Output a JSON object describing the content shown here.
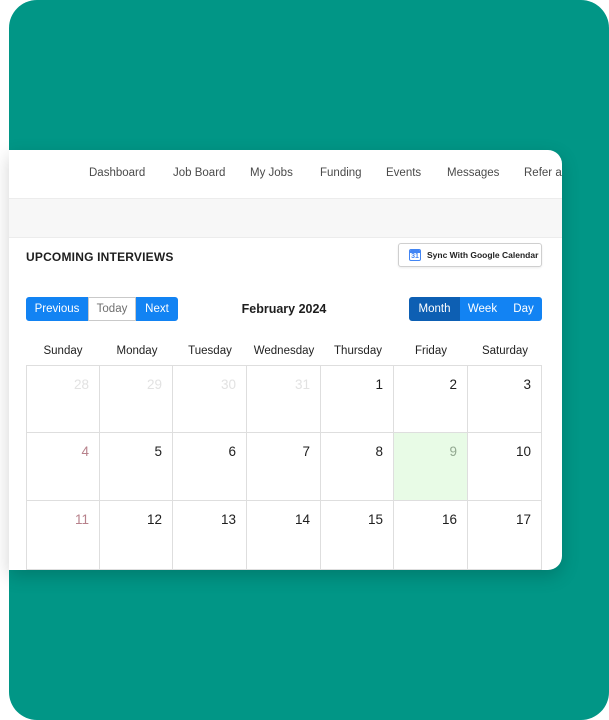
{
  "nav": {
    "items": [
      "Dashboard",
      "Job Board",
      "My Jobs",
      "Funding",
      "Events",
      "Messages",
      "Refer a"
    ]
  },
  "section": {
    "title": "UPCOMING INTERVIEWS",
    "sync_label": "Sync With Google Calendar",
    "sync_icon": "google-calendar-icon",
    "sync_icon_text": "31"
  },
  "calendar": {
    "nav_buttons": {
      "previous": "Previous",
      "today": "Today",
      "next": "Next"
    },
    "month_title": "February 2024",
    "view_buttons": {
      "month": "Month",
      "week": "Week",
      "day": "Day"
    },
    "active_view": "Month",
    "weekdays": [
      "Sunday",
      "Monday",
      "Tuesday",
      "Wednesday",
      "Thursday",
      "Friday",
      "Saturday"
    ],
    "weeks": [
      [
        "28",
        "29",
        "30",
        "31",
        "1",
        "2",
        "3"
      ],
      [
        "4",
        "5",
        "6",
        "7",
        "8",
        "9",
        "10"
      ],
      [
        "11",
        "12",
        "13",
        "14",
        "15",
        "16",
        "17"
      ]
    ],
    "today": "9"
  },
  "colors": {
    "background": "#019686",
    "accent": "#1283f3",
    "active": "#0d5fb3",
    "today_highlight": "#e8fbe6"
  }
}
